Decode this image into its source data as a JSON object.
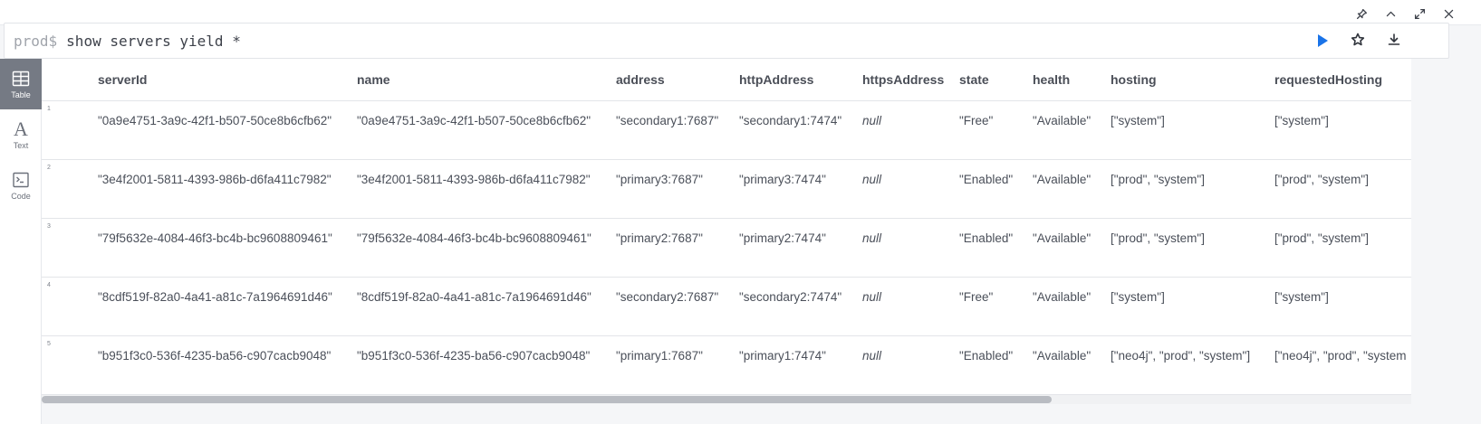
{
  "window": {
    "controls": [
      "pin-icon",
      "collapse-icon",
      "fullscreen-icon",
      "close-icon"
    ]
  },
  "query": {
    "prompt": "prod$",
    "text": "show servers yield *"
  },
  "views": [
    {
      "label": "Table",
      "icon": "table-icon",
      "active": true
    },
    {
      "label": "Text",
      "icon": "text-icon",
      "active": false
    },
    {
      "label": "Code",
      "icon": "code-icon",
      "active": false
    }
  ],
  "table": {
    "columns": [
      "serverId",
      "name",
      "address",
      "httpAddress",
      "httpsAddress",
      "state",
      "health",
      "hosting",
      "requestedHosting"
    ],
    "rows": [
      {
        "num": "1",
        "serverId": "\"0a9e4751-3a9c-42f1-b507-50ce8b6cfb62\"",
        "name": "\"0a9e4751-3a9c-42f1-b507-50ce8b6cfb62\"",
        "address": "\"secondary1:7687\"",
        "httpAddress": "\"secondary1:7474\"",
        "httpsAddress": "null",
        "state": "\"Free\"",
        "health": "\"Available\"",
        "hosting": "[\"system\"]",
        "requestedHosting": "[\"system\"]"
      },
      {
        "num": "2",
        "serverId": "\"3e4f2001-5811-4393-986b-d6fa411c7982\"",
        "name": "\"3e4f2001-5811-4393-986b-d6fa411c7982\"",
        "address": "\"primary3:7687\"",
        "httpAddress": "\"primary3:7474\"",
        "httpsAddress": "null",
        "state": "\"Enabled\"",
        "health": "\"Available\"",
        "hosting": "[\"prod\", \"system\"]",
        "requestedHosting": "[\"prod\", \"system\"]"
      },
      {
        "num": "3",
        "serverId": "\"79f5632e-4084-46f3-bc4b-bc9608809461\"",
        "name": "\"79f5632e-4084-46f3-bc4b-bc9608809461\"",
        "address": "\"primary2:7687\"",
        "httpAddress": "\"primary2:7474\"",
        "httpsAddress": "null",
        "state": "\"Enabled\"",
        "health": "\"Available\"",
        "hosting": "[\"prod\", \"system\"]",
        "requestedHosting": "[\"prod\", \"system\"]"
      },
      {
        "num": "4",
        "serverId": "\"8cdf519f-82a0-4a41-a81c-7a1964691d46\"",
        "name": "\"8cdf519f-82a0-4a41-a81c-7a1964691d46\"",
        "address": "\"secondary2:7687\"",
        "httpAddress": "\"secondary2:7474\"",
        "httpsAddress": "null",
        "state": "\"Free\"",
        "health": "\"Available\"",
        "hosting": "[\"system\"]",
        "requestedHosting": "[\"system\"]"
      },
      {
        "num": "5",
        "serverId": "\"b951f3c0-536f-4235-ba56-c907cacb9048\"",
        "name": "\"b951f3c0-536f-4235-ba56-c907cacb9048\"",
        "address": "\"primary1:7687\"",
        "httpAddress": "\"primary1:7474\"",
        "httpsAddress": "null",
        "state": "\"Enabled\"",
        "health": "\"Available\"",
        "hosting": "[\"neo4j\", \"prod\", \"system\"]",
        "requestedHosting": "[\"neo4j\", \"prod\", \"system"
      }
    ]
  },
  "colors": {
    "run_button": "#1a73e8",
    "active_view_bg": "#757a84",
    "frame_bg": "#f5f6f8"
  }
}
